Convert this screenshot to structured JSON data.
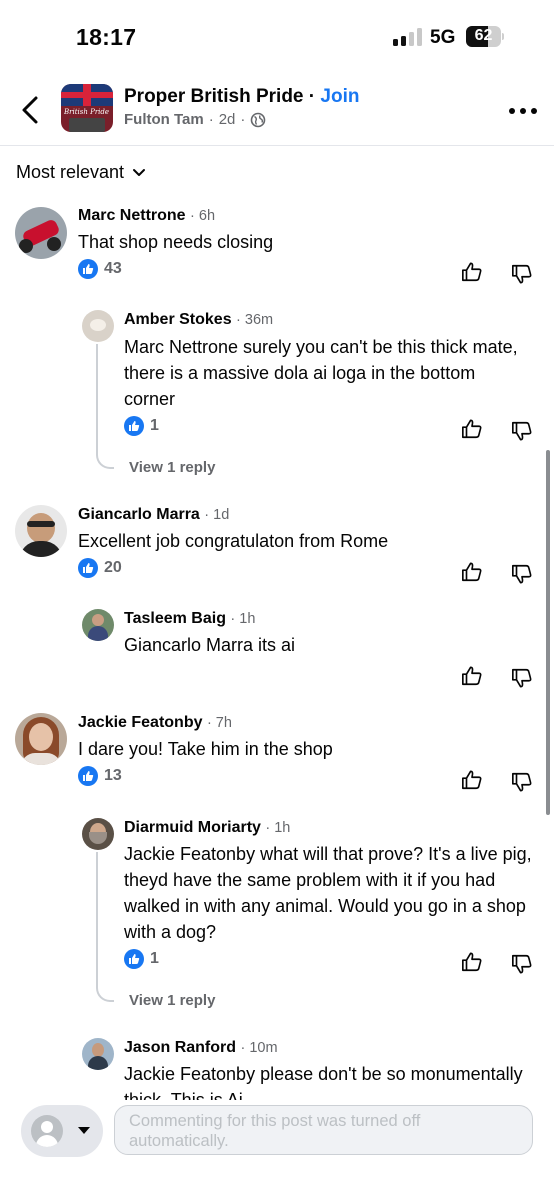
{
  "status_bar": {
    "time": "18:17",
    "network": "5G",
    "battery_level": "62",
    "battery_fraction": 0.62
  },
  "header": {
    "group_name": "Proper British Pride",
    "separator": "·",
    "join_label": "Join",
    "author": "Fulton Tam",
    "age": "2d",
    "avatar_logo_text": "British Pride"
  },
  "sort": {
    "label": "Most relevant"
  },
  "comments": [
    {
      "name": "Marc Nettrone",
      "time": "· 6h",
      "text": "That shop needs closing",
      "likes": "43"
    },
    {
      "name": "Amber Stokes",
      "time": "· 36m",
      "text": "Marc Nettrone surely you can't be this thick mate, there is a massive dola ai loga in the bottom corner",
      "likes": "1",
      "view_replies": "View 1 reply"
    },
    {
      "name": "Giancarlo Marra",
      "time": "· 1d",
      "text": "Excellent job congratulaton from Rome",
      "likes": "20"
    },
    {
      "name": "Tasleem Baig",
      "time": "· 1h",
      "text": "Giancarlo Marra its ai"
    },
    {
      "name": "Jackie Featonby",
      "time": "· 7h",
      "text": "I dare you! Take him in the shop",
      "likes": "13"
    },
    {
      "name": "Diarmuid Moriarty",
      "time": "· 1h",
      "text": "Jackie Featonby what will that prove? It's a live pig, theyd have the same problem with it if you had walked in with any animal. Would you go in a shop with a dog?",
      "likes": "1",
      "view_replies": "View 1 reply"
    },
    {
      "name": "Jason Ranford",
      "time": "· 10m",
      "text": "Jackie Featonby please don't be so monumentally thick. This is Ai."
    }
  ],
  "composer": {
    "placeholder": "Commenting for this post was turned off automatically."
  },
  "colors": {
    "accent": "#1877f2",
    "secondary_text": "#65676b",
    "divider": "#e4e6eb"
  },
  "icons": [
    "back-arrow-icon",
    "globe-icon",
    "more-icon",
    "chevron-down-icon",
    "like-badge-icon",
    "thumbs-up-icon",
    "thumbs-down-icon",
    "profile-icon",
    "caret-down-icon"
  ]
}
